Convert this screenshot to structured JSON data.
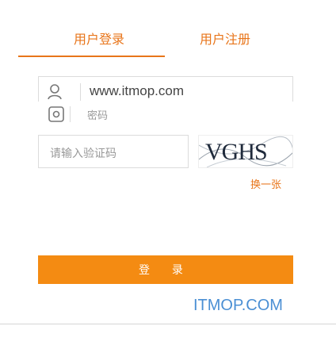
{
  "tabs": {
    "login_label": "用户登录",
    "register_label": "用户注册"
  },
  "form": {
    "username_value": "www.itmop.com",
    "password_placeholder": "密码",
    "captcha_placeholder": "请输入验证码",
    "captcha_image_text": "VGHS",
    "refresh_label": "换一张",
    "submit_label": "登 录"
  },
  "icons": {
    "username": "user-icon",
    "password": "lock-icon"
  },
  "brand": {
    "text": "ITMOP.COM",
    "color": "#4a8fd4"
  },
  "colors": {
    "accent": "#e8751a",
    "button": "#f48b12"
  }
}
